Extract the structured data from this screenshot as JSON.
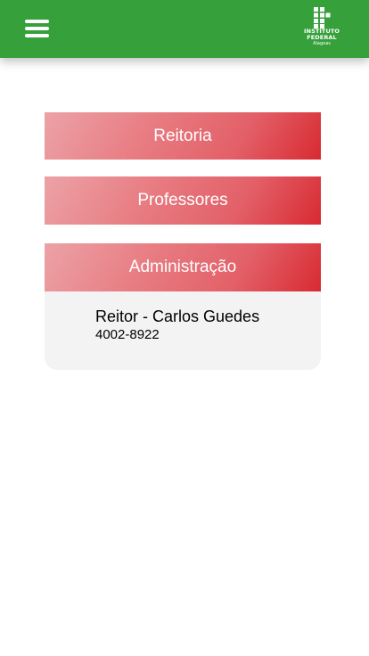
{
  "header": {
    "background_color": "#36a03b",
    "menu_icon": "hamburger-menu-icon",
    "logo": {
      "line1": "INSTITUTO",
      "line2": "FEDERAL",
      "line3": "Alagoas"
    }
  },
  "sections": [
    {
      "label": "Reitoria"
    },
    {
      "label": "Professores"
    },
    {
      "label": "Administração"
    }
  ],
  "admin_panel": {
    "contact_name": "Reitor - Carlos Guedes",
    "contact_phone": "4002-8922"
  },
  "colors": {
    "button_gradient_start": "#eca2a6",
    "button_gradient_end": "#d82a32",
    "panel_background": "#f3f3f3"
  }
}
